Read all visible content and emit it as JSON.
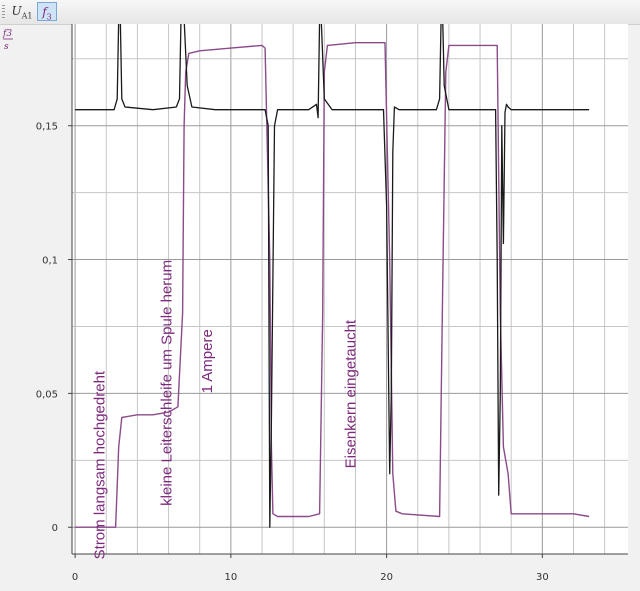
{
  "toolbar": {
    "tab_ua1": {
      "base": "U",
      "sub": "A1"
    },
    "tab_f3": {
      "base": "f",
      "sub": "3"
    }
  },
  "chart_data": {
    "type": "line",
    "x_range": [
      -0.2,
      35.5
    ],
    "y_range": [
      -0.01,
      0.188
    ],
    "x_ticks": [
      0,
      10,
      20,
      30
    ],
    "x_tick_labels": [
      "0",
      "10",
      "20",
      "30"
    ],
    "y_ticks": [
      0,
      0.05,
      0.1,
      0.15
    ],
    "y_tick_labels": [
      "0",
      "0,05",
      "0,1",
      "0,15"
    ],
    "y_unit_label": {
      "num": "f3",
      "den": "s"
    },
    "grid": true,
    "colors": {
      "f3": "#8b4a8b",
      "ua1": "#1a1a1a"
    },
    "series": [
      {
        "id": "f3",
        "x": [
          0,
          2.6,
          2.8,
          3.0,
          4.0,
          5.0,
          6.0,
          6.6,
          6.9,
          7.0,
          7.1,
          7.3,
          8.0,
          10.0,
          12.0,
          12.2,
          12.5,
          12.6,
          12.7,
          13.0,
          15.0,
          15.7,
          15.9,
          16.0,
          16.2,
          18.0,
          19.9,
          20.2,
          20.4,
          20.6,
          21.0,
          23.4,
          23.6,
          23.8,
          24.0,
          26.0,
          27.1,
          27.3,
          27.5,
          27.8,
          28.0,
          30.0,
          32.0,
          33.0
        ],
        "y": [
          0,
          0,
          0.03,
          0.041,
          0.042,
          0.042,
          0.043,
          0.045,
          0.08,
          0.15,
          0.17,
          0.177,
          0.178,
          0.179,
          0.18,
          0.179,
          0.1,
          0.03,
          0.005,
          0.004,
          0.004,
          0.005,
          0.08,
          0.17,
          0.18,
          0.181,
          0.181,
          0.1,
          0.02,
          0.006,
          0.005,
          0.004,
          0.09,
          0.17,
          0.18,
          0.18,
          0.18,
          0.08,
          0.03,
          0.02,
          0.005,
          0.005,
          0.005,
          0.004
        ]
      },
      {
        "id": "ua1",
        "x": [
          0,
          2.5,
          2.7,
          2.8,
          2.9,
          3.0,
          3.2,
          5.0,
          6.5,
          6.7,
          6.8,
          6.9,
          7.0,
          7.2,
          7.5,
          9.0,
          11.0,
          12.2,
          12.4,
          12.5,
          12.6,
          12.8,
          13.0,
          15.0,
          15.5,
          15.6,
          15.7,
          15.8,
          16.0,
          16.5,
          18.0,
          19.8,
          20.0,
          20.2,
          20.3,
          20.4,
          20.5,
          20.8,
          22.0,
          23.2,
          23.4,
          23.5,
          23.6,
          23.7,
          24.0,
          26.0,
          27.0,
          27.1,
          27.2,
          27.3,
          27.4,
          27.5,
          27.6,
          27.7,
          27.8,
          28.0,
          29.0,
          31.0,
          33.0
        ],
        "y": [
          0.156,
          0.156,
          0.16,
          0.19,
          0.19,
          0.16,
          0.157,
          0.156,
          0.157,
          0.16,
          0.19,
          0.19,
          0.19,
          0.165,
          0.157,
          0.156,
          0.156,
          0.156,
          0.15,
          0.0,
          0.04,
          0.15,
          0.156,
          0.156,
          0.158,
          0.153,
          0.19,
          0.19,
          0.16,
          0.156,
          0.156,
          0.156,
          0.12,
          0.02,
          0.05,
          0.14,
          0.157,
          0.156,
          0.156,
          0.156,
          0.16,
          0.19,
          0.19,
          0.165,
          0.156,
          0.156,
          0.156,
          0.1,
          0.012,
          0.05,
          0.15,
          0.106,
          0.155,
          0.158,
          0.157,
          0.156,
          0.156,
          0.156,
          0.156
        ]
      }
    ],
    "annotations": [
      {
        "text": "Strom langsam hochgedreht",
        "x": 1.9,
        "y": -0.012
      },
      {
        "text": "kleine Leiterschleife um Spule herum",
        "x": 6.2,
        "y": 0.008
      },
      {
        "text": "1 Ampere",
        "x": 8.8,
        "y": 0.05
      },
      {
        "text": "Eisenkern eingetaucht",
        "x": 18.0,
        "y": 0.022
      }
    ]
  }
}
